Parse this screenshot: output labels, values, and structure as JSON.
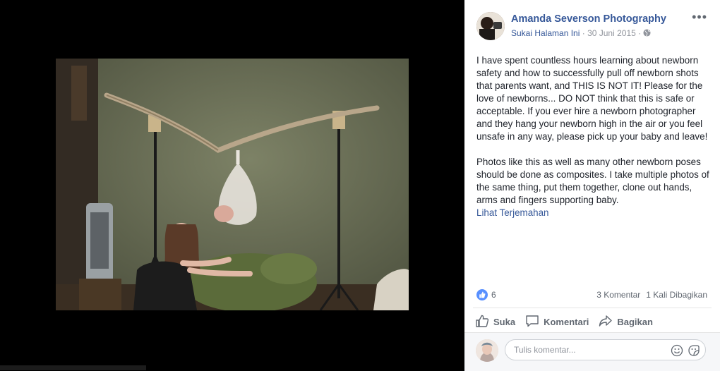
{
  "post": {
    "author": "Amanda Severson Photography",
    "like_page": "Sukai Halaman Ini",
    "separator": " · ",
    "date": "30 Juni 2015",
    "separator2": " · ",
    "paragraph1": "I have spent countless hours learning about newborn safety and how to successfully pull off newborn shots that parents want, and THIS IS NOT IT! Please for the love of newborns... DO NOT think that this is safe or acceptable. If you ever hire a newborn photographer and they hang your newborn high in the air or you feel unsafe in any way, please pick up your baby and leave!",
    "paragraph2": "Photos like this as well as many other newborn poses should be done as composites. I take multiple photos of the same thing, put them together, clone out hands, arms and fingers supporting baby.",
    "translate": "Lihat Terjemahan"
  },
  "stats": {
    "likes": "6",
    "comments": "3 Komentar",
    "shares": "1 Kali Dibagikan"
  },
  "actions": {
    "like": "Suka",
    "comment": "Komentari",
    "share": "Bagikan"
  },
  "comment_box": {
    "placeholder": "Tulis komentar..."
  },
  "icons": {
    "more": "more-options-icon",
    "globe": "globe-icon",
    "like": "thumbs-up-icon",
    "comment": "comment-bubble-icon",
    "share": "share-arrow-icon",
    "emoji": "emoji-icon",
    "sticker": "sticker-icon"
  },
  "colors": {
    "link": "#365899",
    "like_blue": "#5890ff",
    "muted": "#606770",
    "backdrop": "#6e7258"
  }
}
